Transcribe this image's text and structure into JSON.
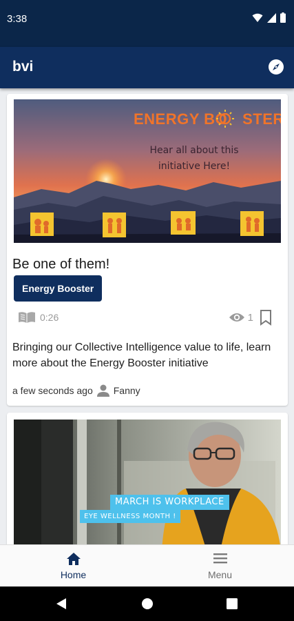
{
  "status_bar": {
    "time": "3:38"
  },
  "app_bar": {
    "title": "bvi",
    "compass_icon": "compass-icon"
  },
  "cards": [
    {
      "image": {
        "logo_part1": "ENERGY BO",
        "logo_part2": "STER",
        "tagline_line1": "Hear all about this",
        "tagline_line2": "initiative Here!"
      },
      "title": "Be one of them!",
      "tag": "Energy Booster",
      "read_time": "0:26",
      "views": "1",
      "description": "Bringing our Collective Intelligence value to life, learn more about the Energy Booster initiative",
      "posted": "a few seconds ago",
      "author": "Fanny"
    },
    {
      "image": {
        "banner_line1": "MARCH IS WORKPLACE",
        "banner_line2": "EYE WELLNESS MONTH !"
      }
    }
  ],
  "bottom_nav": [
    {
      "label": "Home",
      "icon": "home-icon",
      "active": true
    },
    {
      "label": "Menu",
      "icon": "menu-icon",
      "active": false
    }
  ],
  "colors": {
    "primary": "#0f2e5e",
    "status_bar": "#0b2649",
    "accent_banner": "#4ec1ec",
    "logo_orange": "#f0742a"
  }
}
